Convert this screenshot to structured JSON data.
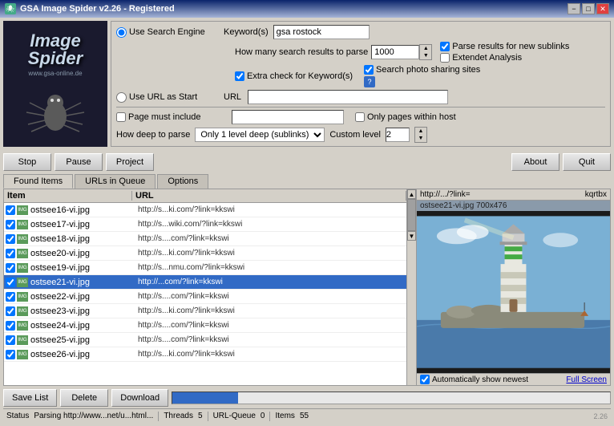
{
  "titlebar": {
    "title": "GSA Image Spider v2.26 - Registered",
    "minimize": "−",
    "maximize": "□",
    "close": "✕"
  },
  "logo": {
    "line1": "Image",
    "line2": "Spider",
    "url": "www.gsa-online.de"
  },
  "controls": {
    "use_search_engine_label": "Use Search Engine",
    "keywords_label": "Keyword(s)",
    "keyword_value": "gsa rostock",
    "parse_results_label": "Parse results for new sublinks",
    "extended_analysis_label": "Extendet Analysis",
    "extra_check_label": "Extra check for Keyword(s)",
    "search_photo_label": "Search photo sharing sites",
    "search_results_label": "How many search results to parse",
    "search_results_value": "1000",
    "use_url_label": "Use URL as Start",
    "url_label": "URL",
    "page_must_include_label": "Page must include",
    "only_pages_label": "Only pages within host",
    "how_deep_label": "How deep to parse",
    "depth_value": "Only 1 level deep (sublinks)",
    "custom_level_label": "Custom level",
    "custom_level_value": "2"
  },
  "buttons": {
    "stop": "Stop",
    "pause": "Pause",
    "project": "Project",
    "about": "About",
    "quit": "Quit"
  },
  "tabs": {
    "items": [
      {
        "label": "Found Items",
        "active": true
      },
      {
        "label": "URLs in Queue",
        "active": false
      },
      {
        "label": "Options",
        "active": false
      }
    ]
  },
  "list": {
    "headers": [
      "Item",
      "URL"
    ],
    "rows": [
      {
        "name": "ostsee16-vi.jpg",
        "url": "http://s...ki.com/?link=kkswi",
        "checked": true,
        "selected": false
      },
      {
        "name": "ostsee17-vi.jpg",
        "url": "http://s...wiki.com/?link=kkswi",
        "checked": true,
        "selected": false
      },
      {
        "name": "ostsee18-vi.jpg",
        "url": "http://s....com/?link=kkswi",
        "checked": true,
        "selected": false
      },
      {
        "name": "ostsee20-vi.jpg",
        "url": "http://s...ki.com/?link=kkswi",
        "checked": true,
        "selected": false
      },
      {
        "name": "ostsee19-vi.jpg",
        "url": "http://s...nmu.com/?link=kkswi",
        "checked": true,
        "selected": false
      },
      {
        "name": "ostsee21-vi.jpg",
        "url": "http://...com/?link=kkswi",
        "checked": true,
        "selected": true
      },
      {
        "name": "ostsee22-vi.jpg",
        "url": "http://s....com/?link=kkswi",
        "checked": true,
        "selected": false
      },
      {
        "name": "ostsee23-vi.jpg",
        "url": "http://s...ki.com/?link=kkswi",
        "checked": true,
        "selected": false
      },
      {
        "name": "ostsee24-vi.jpg",
        "url": "http://s....com/?link=kkswi",
        "checked": true,
        "selected": false
      },
      {
        "name": "ostsee25-vi.jpg",
        "url": "http://s....com/?link=kkswi",
        "checked": true,
        "selected": false
      },
      {
        "name": "ostsee26-vi.jpg",
        "url": "http://s...ki.com/?link=kkswi",
        "checked": true,
        "selected": false
      }
    ]
  },
  "preview": {
    "url_text": "http://.../?link=",
    "size_text": "kqrtbx",
    "size_detail": "ostsee21-vi.jpg 700x476",
    "auto_show_label": "Automatically show newest",
    "full_screen_label": "Full Screen"
  },
  "bottom": {
    "save_list": "Save List",
    "delete": "Delete",
    "download": "Download"
  },
  "statusbar": {
    "status_label": "Status",
    "status_value": "Parsing http://www...net/u...html...",
    "threads_label": "Threads",
    "threads_value": "5",
    "url_queue_label": "URL-Queue",
    "url_queue_value": "0",
    "items_label": "Items",
    "items_value": "55"
  },
  "version": "2.26"
}
